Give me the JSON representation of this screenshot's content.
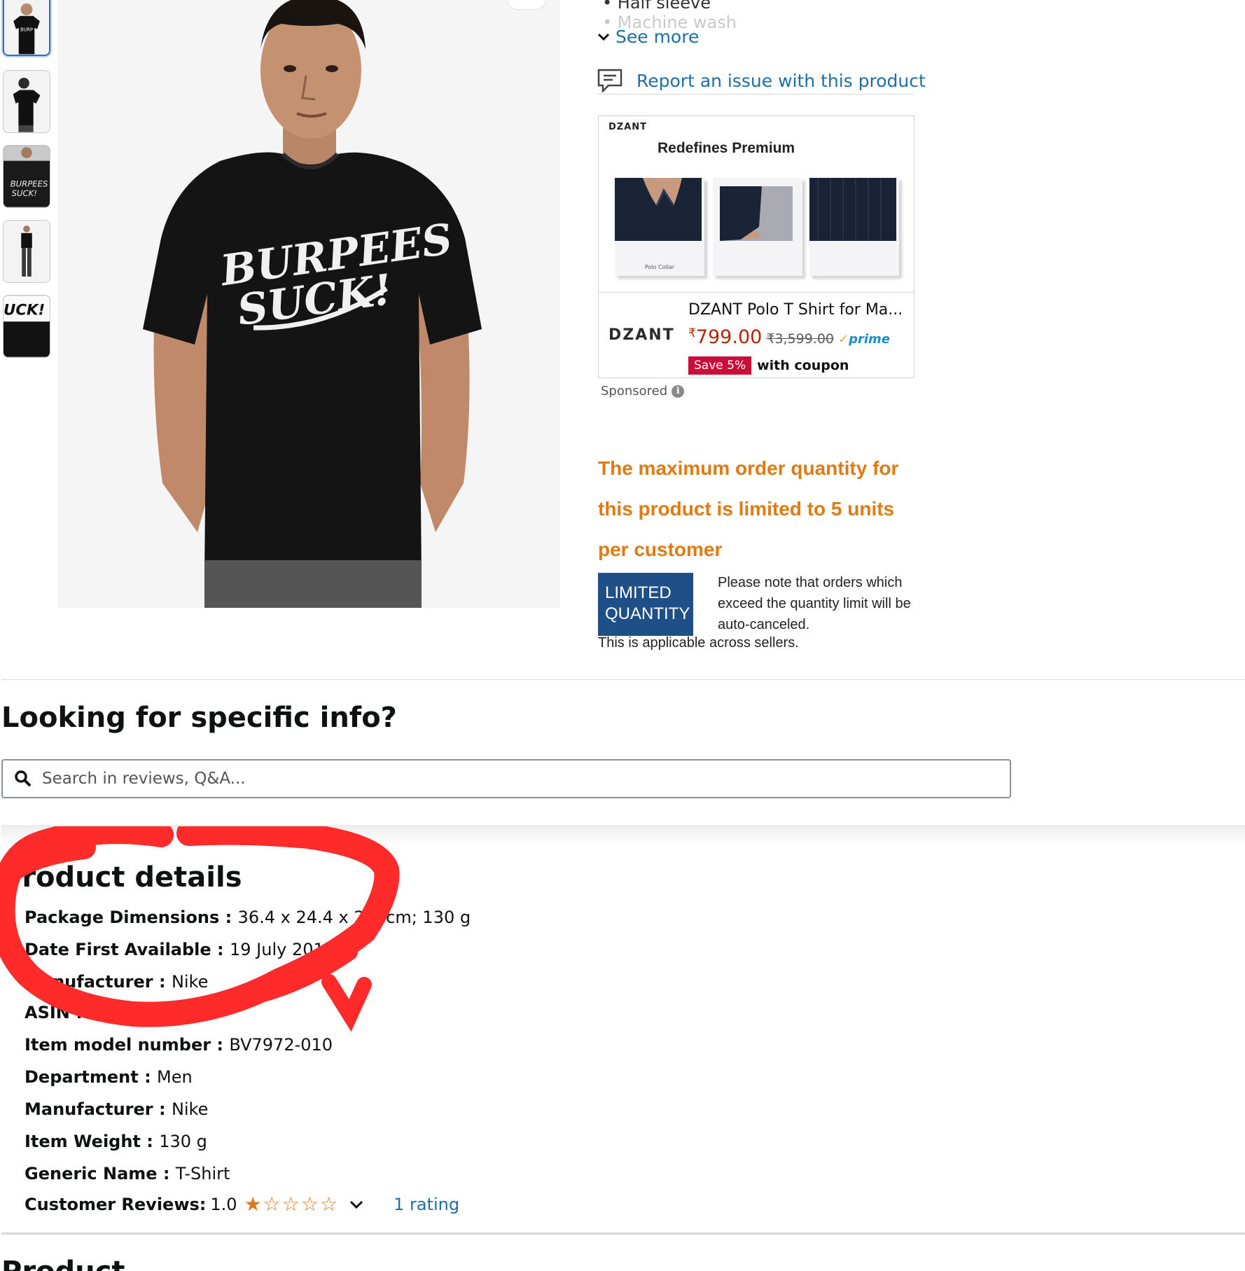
{
  "bullets": {
    "partial_top": "Half sleeve",
    "faded": "Machine wash"
  },
  "see_more": "See more",
  "report_issue": "Report an issue with this product",
  "ad": {
    "brand_small": "DZANT",
    "tagline": "Redefines Premium",
    "tile_caption": "Polo Collar",
    "brand_big": "DZANT",
    "title": "DZANT Polo T Shirt for Ma...",
    "price_symbol": "₹",
    "price": "799.00",
    "old_price": "₹3,599.00",
    "prime": "prime",
    "save_badge": "Save 5%",
    "coupon_text": "with coupon",
    "sponsored": "Sponsored"
  },
  "product_image_text": "BURPEES SUCK!",
  "limit": {
    "warning": "The maximum order quantity for this product is limited to 5 units per customer",
    "badge_line1": "LIMITED",
    "badge_line2": "QUANTITY",
    "note": "Please note that orders which exceed the quantity limit will be auto-canceled.",
    "note2": "This is applicable across sellers."
  },
  "looking": {
    "title": "Looking for specific info?",
    "placeholder": "Search in reviews, Q&A..."
  },
  "product_details": {
    "title": "Product details",
    "rows": [
      {
        "key": "Package Dimensions",
        "value": "36.4 x 24.4 x 2.8 cm; 130 g"
      },
      {
        "key": "Date First Available",
        "value": "19 July 2019"
      },
      {
        "key": "Manufacturer",
        "value": "Nike"
      },
      {
        "key": "ASIN",
        "value": ""
      },
      {
        "key": "Item model number",
        "value": "BV7972-010"
      },
      {
        "key": "Department",
        "value": "Men"
      },
      {
        "key": "Manufacturer",
        "value": "Nike"
      },
      {
        "key": "Item Weight",
        "value": "130 g"
      },
      {
        "key": "Generic Name",
        "value": "T-Shirt"
      }
    ],
    "reviews_label": "Customer Reviews:",
    "reviews_score": "1.0",
    "stars_filled": 1,
    "stars_total": 5,
    "rating_count": "1 rating"
  },
  "next_section": "Product description",
  "colors": {
    "link": "#1e6ea7",
    "price": "#b12704",
    "warning": "#e07b14",
    "annotation": "#ff2a2a",
    "limited_badge": "#1f4f87"
  }
}
